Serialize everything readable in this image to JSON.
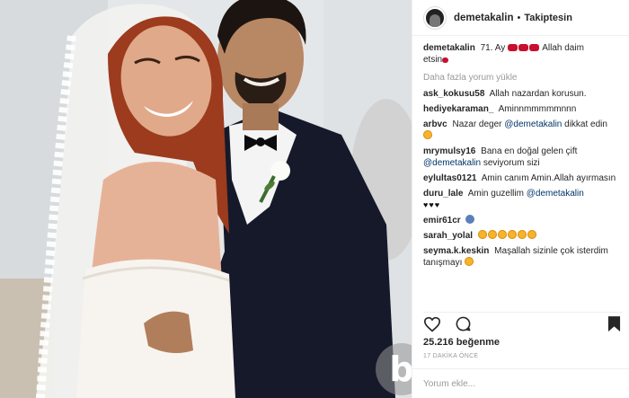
{
  "post": {
    "username": "demetakalin",
    "separator": "•",
    "follow_label": "Takiptesin",
    "caption_user": "demetakalin",
    "caption_text": "71. Ay",
    "caption_text_2": "Allah daim",
    "caption_text_3": "etsin",
    "load_more": "Daha fazla yorum yükle",
    "likes": "25.216 beğenme",
    "time": "17 DAKİKA ÖNCE",
    "comment_placeholder": "Yorum ekle...",
    "watermark": "b"
  },
  "comments": [
    {
      "user": "ask_kokusu58",
      "text": "Allah nazardan korusun."
    },
    {
      "user": "hediyekaraman_",
      "text": "Aminnmmmmmnnn"
    },
    {
      "user": "arbvc",
      "text": "Nazar deger",
      "mention": "@demetakalin",
      "text_after": "dikkat edin"
    },
    {
      "user": "mrymulsy16",
      "text": "Bana en doğal gelen çift",
      "mention": "@demetakalin",
      "text_after": "seviyorum sizi"
    },
    {
      "user": "eylultas0121",
      "text": "Amin canım Amin.Allah ayırmasın"
    },
    {
      "user": "duru_lale",
      "text": "Amin guzellim",
      "mention": "@demetakalin",
      "hearts": "♥♥♥"
    },
    {
      "user": "emir61cr",
      "text": ""
    },
    {
      "user": "sarah_yolal",
      "text": ""
    },
    {
      "user": "seyma.k.keskin",
      "text": "Maşallah sizinle çok isterdim tanışmayı"
    }
  ],
  "icons": {
    "avatar": "profile-avatar",
    "like": "heart-outline-icon",
    "comment": "comment-bubble-icon",
    "save": "bookmark-icon"
  },
  "colors": {
    "text": "#262626",
    "muted": "#999999",
    "mention": "#003569",
    "border": "#efefef"
  }
}
